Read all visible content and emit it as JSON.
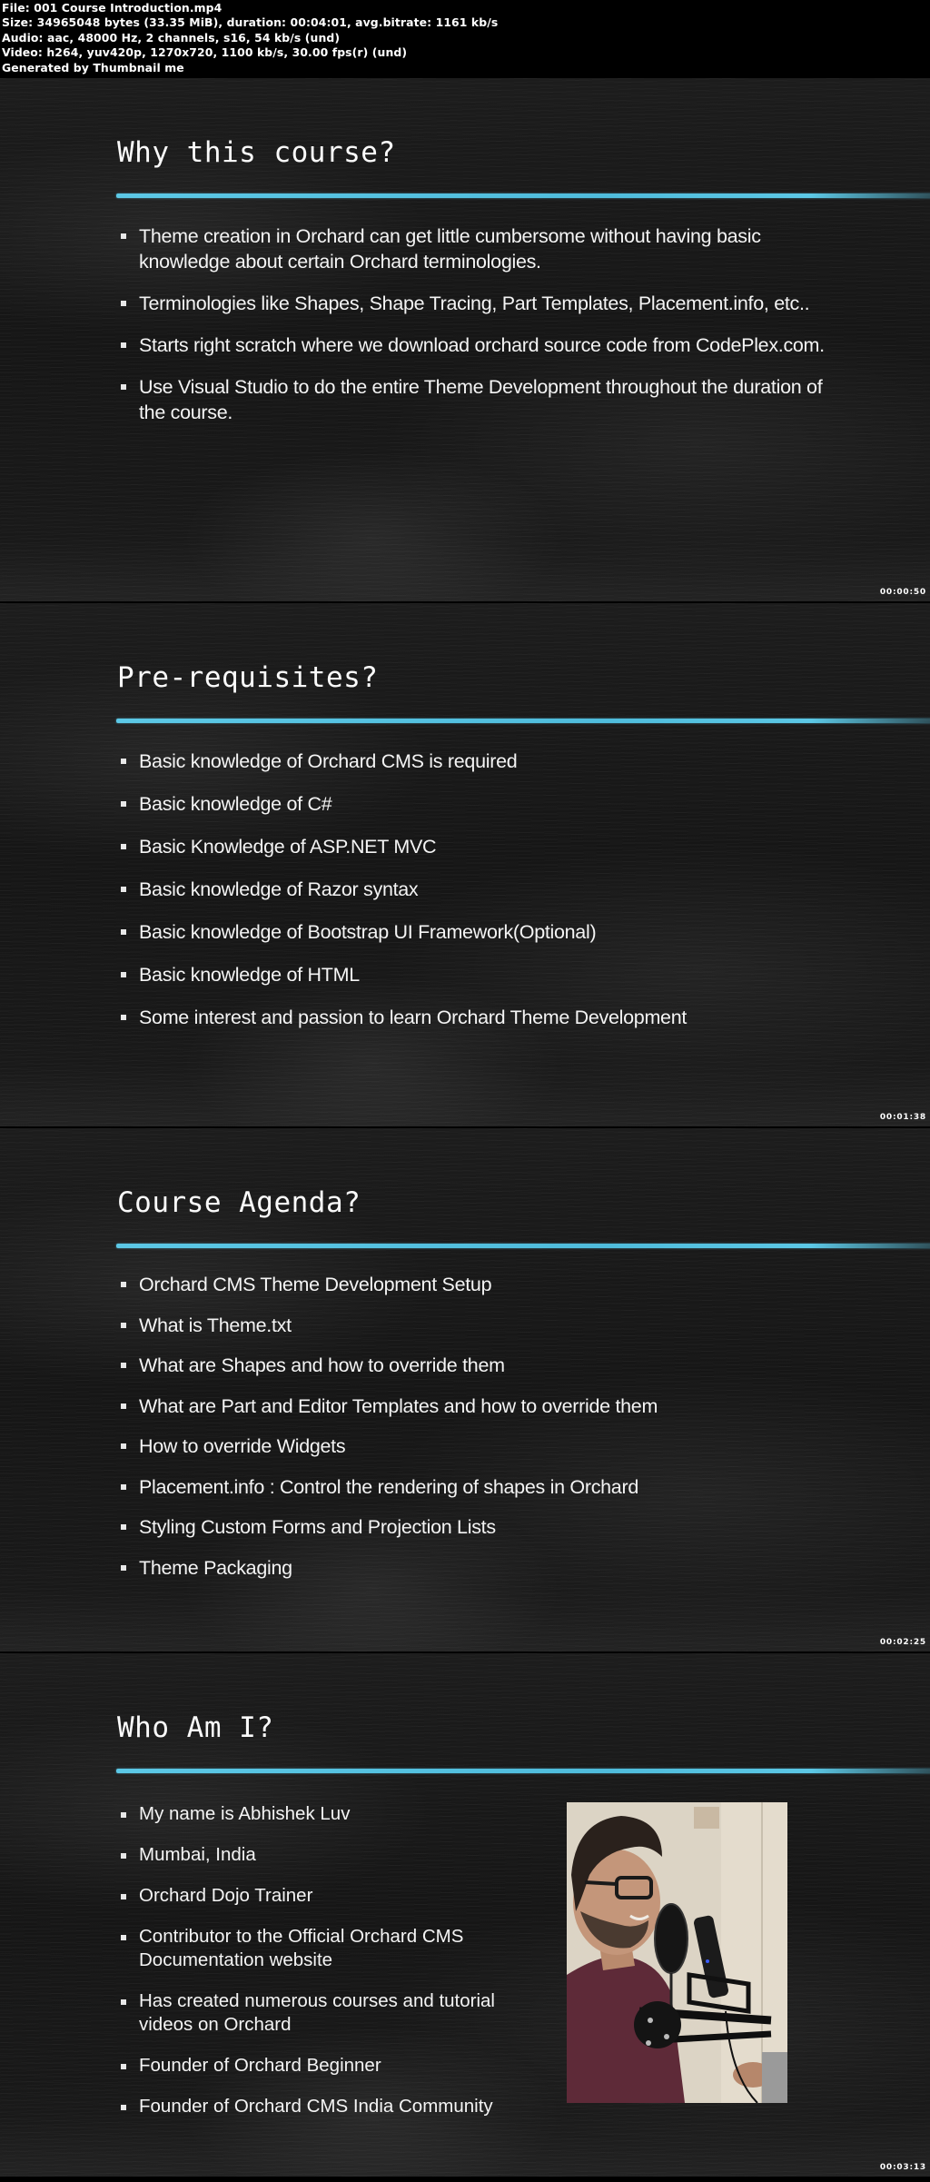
{
  "meta": {
    "lines": [
      "File: 001 Course Introduction.mp4",
      "Size: 34965048 bytes (33.35 MiB), duration: 00:04:01, avg.bitrate: 1161 kb/s",
      "Audio: aac, 48000 Hz, 2 channels, s16, 54 kb/s (und)",
      "Video: h264, yuv420p, 1270x720, 1100 kb/s, 30.00 fps(r) (und)",
      "Generated by Thumbnail me"
    ]
  },
  "colors": {
    "accent_rule": "#5cc8e6",
    "background": "#181818",
    "text": "#f4f4f4"
  },
  "slides": [
    {
      "title": "Why this course?",
      "timestamp": "00:00:50",
      "bullets": [
        "Theme creation in Orchard can get little cumbersome without having basic knowledge about certain Orchard terminologies.",
        "Terminologies like Shapes, Shape Tracing, Part Templates, Placement.info, etc..",
        "Starts right scratch where we download orchard source code from CodePlex.com.",
        "Use Visual Studio to do the entire Theme Development throughout the duration of the course."
      ]
    },
    {
      "title": "Pre-requisites?",
      "timestamp": "00:01:38",
      "bullets": [
        "Basic knowledge of Orchard CMS is required",
        "Basic knowledge of C#",
        "Basic Knowledge of ASP.NET MVC",
        "Basic knowledge of Razor syntax",
        "Basic knowledge of Bootstrap UI Framework(Optional)",
        "Basic knowledge of HTML",
        "Some interest and passion to learn Orchard Theme Development"
      ]
    },
    {
      "title": "Course Agenda?",
      "timestamp": "00:02:25",
      "bullets": [
        "Orchard CMS Theme Development Setup",
        "What is Theme.txt",
        "What are Shapes and how to override them",
        "What are Part and Editor Templates and how to override them",
        "How to override Widgets",
        "Placement.info : Control the rendering of shapes in Orchard",
        "Styling Custom Forms and Projection Lists",
        "Theme Packaging"
      ]
    },
    {
      "title": "Who Am I?",
      "timestamp": "00:03:13",
      "bullets": [
        "My name is Abhishek Luv",
        "Mumbai, India",
        "Orchard Dojo Trainer",
        "Contributor to the Official Orchard CMS Documentation website",
        "Has created numerous courses and tutorial videos on Orchard",
        "Founder of Orchard Beginner",
        "Founder of Orchard CMS India Community"
      ],
      "photo_alt": "Presenter photo with microphone"
    }
  ]
}
